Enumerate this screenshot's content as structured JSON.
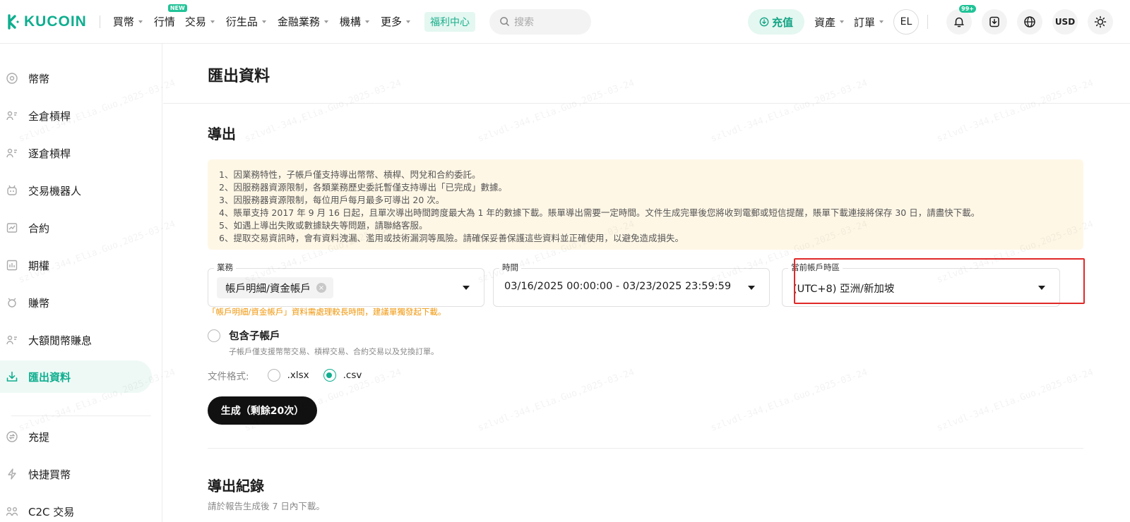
{
  "header": {
    "logo_text": "KUCOIN",
    "nav": [
      {
        "label": "買幣",
        "dropdown": true
      },
      {
        "label": "行情",
        "dropdown": false,
        "badge": "NEW"
      },
      {
        "label": "交易",
        "dropdown": true
      },
      {
        "label": "衍生品",
        "dropdown": true
      },
      {
        "label": "金融業務",
        "dropdown": true
      },
      {
        "label": "機構",
        "dropdown": true
      },
      {
        "label": "更多",
        "dropdown": true
      }
    ],
    "welfare_label": "福利中心",
    "search_placeholder": "搜索",
    "deposit_label": "充值",
    "assets_label": "資產",
    "orders_label": "訂單",
    "avatar_initials": "EL",
    "notif_badge": "99+",
    "currency": "USD"
  },
  "sidebar": {
    "items": [
      {
        "label": "幣幣",
        "icon": "coin-icon"
      },
      {
        "label": "全倉槓桿",
        "icon": "cross-margin-icon"
      },
      {
        "label": "逐倉槓桿",
        "icon": "isolated-margin-icon"
      },
      {
        "label": "交易機器人",
        "icon": "robot-icon"
      },
      {
        "label": "合約",
        "icon": "futures-icon"
      },
      {
        "label": "期權",
        "icon": "options-icon"
      },
      {
        "label": "賺幣",
        "icon": "earn-icon"
      },
      {
        "label": "大額閒幣賺息",
        "icon": "vip-earn-icon"
      },
      {
        "label": "匯出資料",
        "icon": "download-icon",
        "active": true
      }
    ],
    "items_bottom": [
      {
        "label": "充提",
        "icon": "deposit-withdraw-icon"
      },
      {
        "label": "快捷買幣",
        "icon": "fast-buy-icon"
      },
      {
        "label": "C2C 交易",
        "icon": "c2c-icon"
      }
    ]
  },
  "main": {
    "page_title": "匯出資料",
    "section_title": "導出",
    "notices": [
      "1、因業務特性，子帳戶僅支持導出幣幣、槓桿、閃兌和合約委託。",
      "2、因服務器資源限制，各類業務歷史委託暫僅支持導出「已完成」數據。",
      "3、因服務器資源限制，每位用戶每月最多可導出 20 次。",
      "4、賬單支持 2017 年 9 月 16 日起，且單次導出時間跨度最大為 1 年的數據下載。賬單導出需要一定時間。文件生成完畢後您將收到電郵或短信提醒，賬單下載連接將保存 30 日，請盡快下載。",
      "5、如遇上導出失敗或數據缺失等問題，請聯絡客服。",
      "6、提取交易資訊時，會有資料洩漏、濫用或技術漏洞等風險。請確保妥善保護這些資料並正確使用，以避免造成損失。"
    ],
    "business_field": {
      "label": "業務",
      "value": "帳戶明細/資金帳戶"
    },
    "time_field": {
      "label": "時間",
      "value": "03/16/2025 00:00:00 - 03/23/2025 23:59:59"
    },
    "timezone_field": {
      "label": "當前帳戶時區",
      "value": "(UTC+8) 亞洲/新加坡"
    },
    "warning": "「帳戶明細/資金帳戶」資料需處理較長時間，建議單獨發起下載。",
    "include_sub_label": "包含子帳戶",
    "include_sub_hint": "子帳戶僅支援幣幣交易、槓桿交易、合約交易以及兌換訂單。",
    "format_label": "文件格式:",
    "formats": [
      ".xlsx",
      ".csv"
    ],
    "selected_format": ".csv",
    "generate_label": "生成（剩餘20次）",
    "records_title": "導出紀錄",
    "records_hint": "請於報告生成後 7 日內下載。"
  },
  "watermark": "szlvdl-344,Elia.Guo,2025-03-24",
  "colors": {
    "accent": "#0fae8f",
    "warning": "#f0960a",
    "highlight_box": "#e02828",
    "notice_bg": "#fff7e6"
  }
}
